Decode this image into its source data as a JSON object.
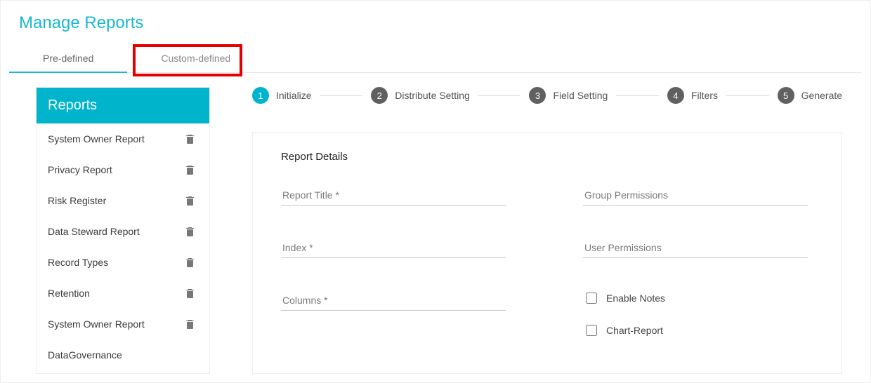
{
  "title": "Manage Reports",
  "tabs": {
    "predefined": "Pre-defined",
    "custom": "Custom-defined"
  },
  "sidebar": {
    "header": "Reports",
    "items": [
      {
        "label": "System Owner Report"
      },
      {
        "label": "Privacy Report"
      },
      {
        "label": "Risk Register"
      },
      {
        "label": "Data Steward Report"
      },
      {
        "label": "Record Types"
      },
      {
        "label": "Retention"
      },
      {
        "label": "System Owner Report"
      },
      {
        "label": "DataGovernance"
      }
    ]
  },
  "stepper": [
    {
      "num": "1",
      "label": "Initialize",
      "active": true
    },
    {
      "num": "2",
      "label": "Distribute Setting",
      "active": false
    },
    {
      "num": "3",
      "label": "Field Setting",
      "active": false
    },
    {
      "num": "4",
      "label": "Filters",
      "active": false
    },
    {
      "num": "5",
      "label": "Generate",
      "active": false
    }
  ],
  "card": {
    "title": "Report Details",
    "fields": {
      "report_title": "Report Title *",
      "group_permissions": "Group Permissions",
      "index": "Index *",
      "user_permissions": "User Permissions",
      "columns": "Columns *"
    },
    "checks": {
      "enable_notes": "Enable Notes",
      "chart_report": "Chart-Report"
    }
  }
}
